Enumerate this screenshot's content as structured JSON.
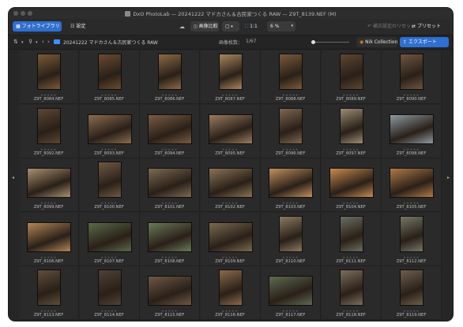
{
  "window": {
    "title": "DxO PhotoLab — 20241222 マドカさん＆古民家つくる RAW — Z9T_8139.NEF (M)"
  },
  "toolbar": {
    "library_tab": "フォトライブラリ",
    "edit_tab": "設定",
    "compare_label": "画像比較",
    "ratio_label": "1:1",
    "zoom_value": "6 %",
    "reset_label": "補正設定のリセット",
    "preset_label": "プリセット"
  },
  "pathbar": {
    "folder": "20241222 マドカさん＆古民家つくる RAW",
    "count_label": "画像枚数：",
    "count_value": "1/67",
    "nik_label": "Nik Collection",
    "export_label": "エクスポート"
  },
  "thumbnails": [
    {
      "name": "Z9T_8084.NEF",
      "orientation": "portrait",
      "tone": "#7a5a3a"
    },
    {
      "name": "Z9T_8085.NEF",
      "orientation": "portrait",
      "tone": "#6b4a32"
    },
    {
      "name": "Z9T_8086.NEF",
      "orientation": "portrait",
      "tone": "#8a6a48"
    },
    {
      "name": "Z9T_8087.NEF",
      "orientation": "portrait",
      "tone": "#a8865e"
    },
    {
      "name": "Z9T_8088.NEF",
      "orientation": "portrait",
      "tone": "#7c5a3c"
    },
    {
      "name": "Z9T_8089.NEF",
      "orientation": "portrait",
      "tone": "#5e4632"
    },
    {
      "name": "Z9T_8090.NEF",
      "orientation": "portrait",
      "tone": "#6e5640"
    },
    {
      "name": "Z9T_8092.NEF",
      "orientation": "portrait",
      "tone": "#5c4634"
    },
    {
      "name": "Z9T_8093.NEF",
      "orientation": "landscape",
      "tone": "#8a6c50"
    },
    {
      "name": "Z9T_8094.NEF",
      "orientation": "landscape",
      "tone": "#7a5c44"
    },
    {
      "name": "Z9T_8095.NEF",
      "orientation": "landscape",
      "tone": "#9a7c60"
    },
    {
      "name": "Z9T_8096.NEF",
      "orientation": "portrait",
      "tone": "#7e6650"
    },
    {
      "name": "Z9T_8097.NEF",
      "orientation": "portrait",
      "tone": "#9c8c74"
    },
    {
      "name": "Z9T_8098.NEF",
      "orientation": "landscape",
      "tone": "#8e9aa0"
    },
    {
      "name": "Z9T_8099.NEF",
      "orientation": "landscape",
      "tone": "#a89070"
    },
    {
      "name": "Z9T_8100.NEF",
      "orientation": "portrait",
      "tone": "#6e5a44"
    },
    {
      "name": "Z9T_8101.NEF",
      "orientation": "landscape",
      "tone": "#7c6a54"
    },
    {
      "name": "Z9T_8102.NEF",
      "orientation": "landscape",
      "tone": "#8a7456"
    },
    {
      "name": "Z9T_8103.NEF",
      "orientation": "landscape",
      "tone": "#c09060"
    },
    {
      "name": "Z9T_8104.NEF",
      "orientation": "landscape",
      "tone": "#c88a50"
    },
    {
      "name": "Z9T_8105.NEF",
      "orientation": "landscape",
      "tone": "#b07a48"
    },
    {
      "name": "Z9T_8106.NEF",
      "orientation": "landscape",
      "tone": "#b48658"
    },
    {
      "name": "Z9T_8107.NEF",
      "orientation": "landscape",
      "tone": "#5a6a4a"
    },
    {
      "name": "Z9T_8108.NEF",
      "orientation": "landscape",
      "tone": "#6a7a58"
    },
    {
      "name": "Z9T_8109.NEF",
      "orientation": "landscape",
      "tone": "#7a6a50"
    },
    {
      "name": "Z9T_8110.NEF",
      "orientation": "portrait",
      "tone": "#8a7a62"
    },
    {
      "name": "Z9T_8111.NEF",
      "orientation": "portrait",
      "tone": "#6a6e60"
    },
    {
      "name": "Z9T_8112.NEF",
      "orientation": "portrait",
      "tone": "#747866"
    },
    {
      "name": "Z9T_8113.NEF",
      "orientation": "portrait",
      "tone": "#5e4e3c"
    },
    {
      "name": "Z9T_8114.NEF",
      "orientation": "portrait",
      "tone": "#4e4238"
    },
    {
      "name": "Z9T_8115.NEF",
      "orientation": "landscape",
      "tone": "#6e5846"
    },
    {
      "name": "Z9T_8116.NEF",
      "orientation": "portrait",
      "tone": "#8a6a4c"
    },
    {
      "name": "Z9T_8117.NEF",
      "orientation": "landscape",
      "tone": "#5e6a52"
    },
    {
      "name": "Z9T_8118.NEF",
      "orientation": "portrait",
      "tone": "#7a6e5e"
    },
    {
      "name": "Z9T_8119.NEF",
      "orientation": "portrait",
      "tone": "#6e5e4e"
    }
  ]
}
